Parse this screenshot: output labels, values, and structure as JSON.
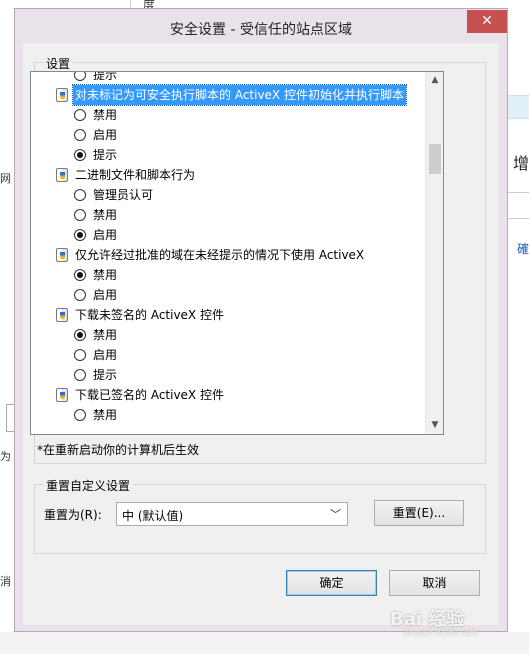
{
  "background": {
    "top_text": "度",
    "left_text_1": "网",
    "left_text_2": "为",
    "left_text_3": "消",
    "right_text_1": "增",
    "right_text_2": "確"
  },
  "dialog": {
    "title": "安全设置 - 受信任的站点区域",
    "close_glyph": "✕"
  },
  "settings": {
    "legend": "设置",
    "rows": [
      {
        "kind": "option",
        "label": "提示",
        "checked": false
      },
      {
        "kind": "category",
        "label": "对未标记为可安全执行脚本的 ActiveX 控件初始化并执行脚本",
        "selected": true
      },
      {
        "kind": "option",
        "label": "禁用",
        "checked": false
      },
      {
        "kind": "option",
        "label": "启用",
        "checked": false
      },
      {
        "kind": "option",
        "label": "提示",
        "checked": true
      },
      {
        "kind": "category",
        "label": "二进制文件和脚本行为",
        "selected": false
      },
      {
        "kind": "option",
        "label": "管理员认可",
        "checked": false
      },
      {
        "kind": "option",
        "label": "禁用",
        "checked": false
      },
      {
        "kind": "option",
        "label": "启用",
        "checked": true
      },
      {
        "kind": "category",
        "label": "仅允许经过批准的域在未经提示的情况下使用 ActiveX",
        "selected": false
      },
      {
        "kind": "option",
        "label": "禁用",
        "checked": true
      },
      {
        "kind": "option",
        "label": "启用",
        "checked": false
      },
      {
        "kind": "category",
        "label": "下载未签名的 ActiveX 控件",
        "selected": false
      },
      {
        "kind": "option",
        "label": "禁用",
        "checked": true
      },
      {
        "kind": "option",
        "label": "启用",
        "checked": false
      },
      {
        "kind": "option",
        "label": "提示",
        "checked": false
      },
      {
        "kind": "category",
        "label": "下载已签名的 ActiveX 控件",
        "selected": false
      },
      {
        "kind": "option",
        "label": "禁用",
        "checked": false
      }
    ],
    "note": "*在重新启动你的计算机后生效"
  },
  "reset": {
    "legend": "重置自定义设置",
    "label": "重置为(R):",
    "level_value": "中 (默认值)",
    "reset_button": "重置(E)..."
  },
  "footer": {
    "ok": "确定",
    "cancel": "取消"
  },
  "watermark": {
    "text": "Bai 经验",
    "sub": "jingyan.baidu.com"
  }
}
